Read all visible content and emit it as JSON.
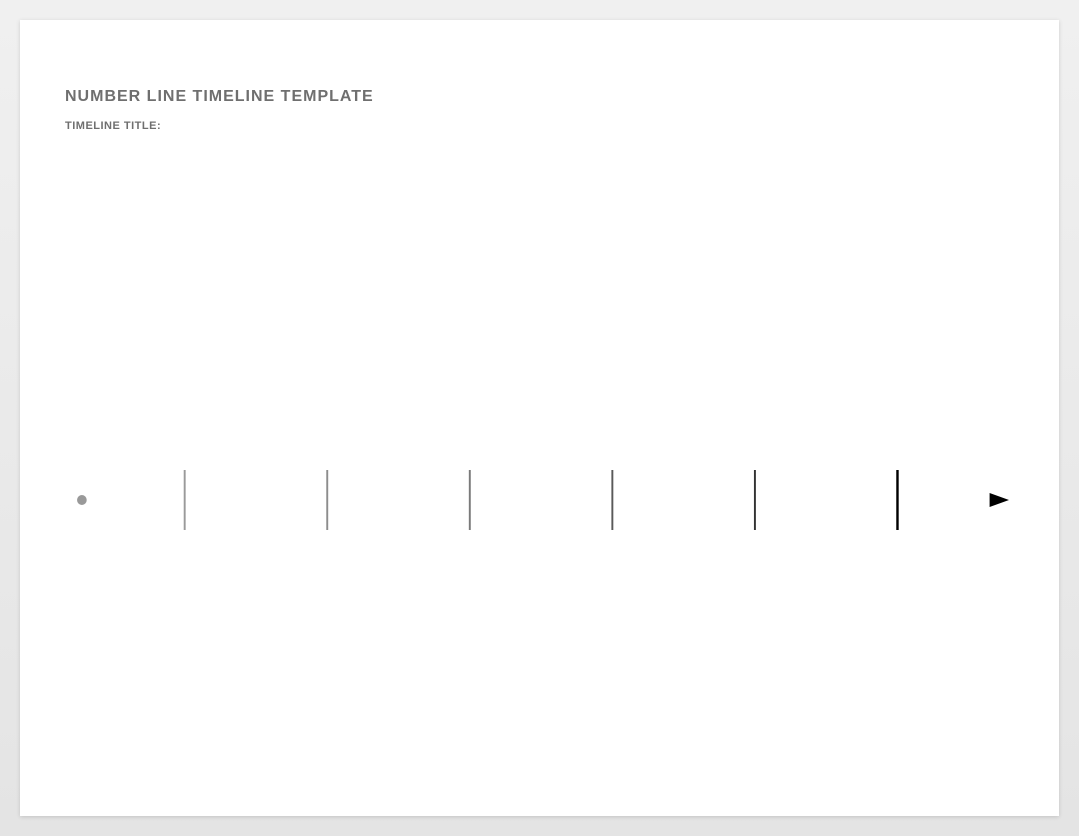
{
  "header": {
    "title": "NUMBER LINE TIMELINE TEMPLATE",
    "subtitle": "TIMELINE TITLE:"
  },
  "timeline": {
    "ticks": 6,
    "start_color": "#999999",
    "end_color": "#000000"
  }
}
